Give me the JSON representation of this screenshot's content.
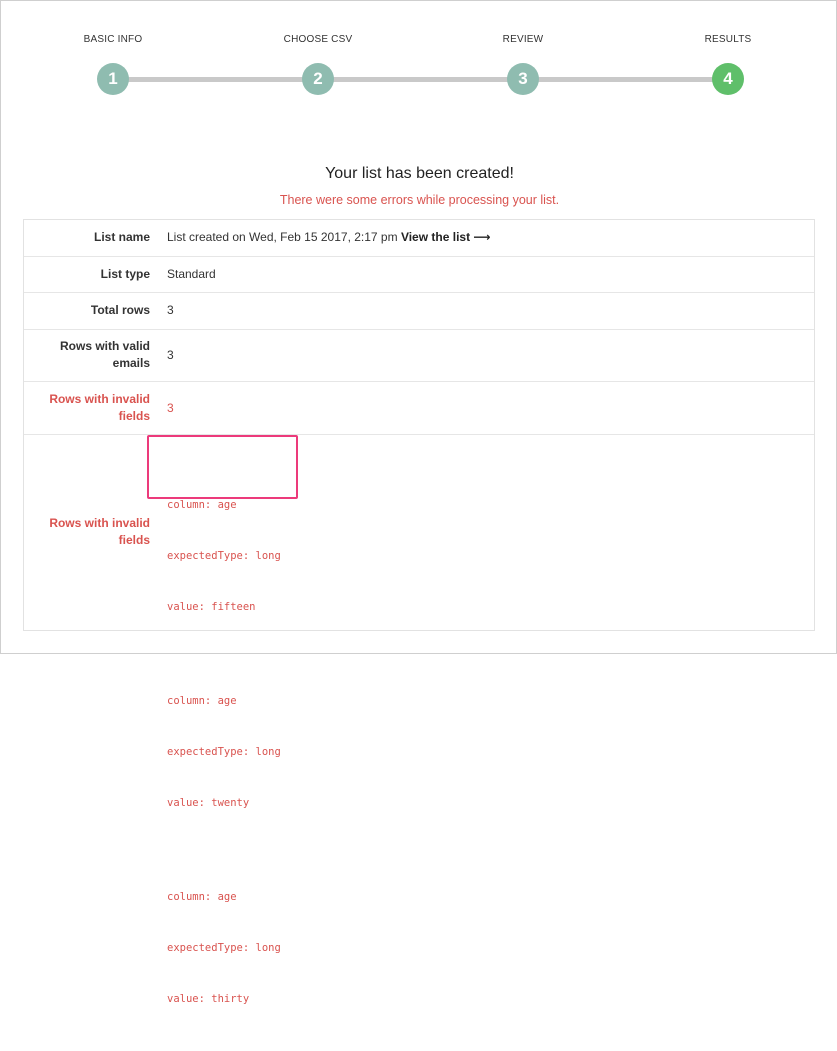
{
  "colors": {
    "step_done": "#8fbcb0",
    "step_active": "#5fbf6a",
    "error_red": "#d9534f",
    "highlight": "#ec3a7b"
  },
  "steps": [
    {
      "label": "BASIC INFO",
      "number": "1",
      "state": "done"
    },
    {
      "label": "CHOOSE CSV",
      "number": "2",
      "state": "done"
    },
    {
      "label": "REVIEW",
      "number": "3",
      "state": "done"
    },
    {
      "label": "RESULTS",
      "number": "4",
      "state": "active"
    }
  ],
  "result": {
    "title": "Your list has been created!",
    "error_message": "There were some errors while processing your list."
  },
  "summary": {
    "list_name_label": "List name",
    "list_name_value": "List created on Wed, Feb 15 2017, 2:17 pm",
    "view_link": "View the list",
    "view_link_icon": "⟶",
    "list_type_label": "List type",
    "list_type_value": "Standard",
    "total_rows_label": "Total rows",
    "total_rows_value": "3",
    "valid_emails_label_1": "Rows with valid",
    "valid_emails_label_2": "emails",
    "valid_emails_value": "3",
    "invalid_fields_label_1": "Rows with invalid",
    "invalid_fields_label_2": "fields",
    "invalid_fields_value": "3"
  },
  "invalid_details": {
    "label_1": "Rows with invalid",
    "label_2": "fields",
    "errors": [
      {
        "column": "column: age",
        "expected": "expectedType: long",
        "value": "value: fifteen"
      },
      {
        "column": "column: age",
        "expected": "expectedType: long",
        "value": "value: twenty"
      },
      {
        "column": "column: age",
        "expected": "expectedType: long",
        "value": "value: thirty"
      }
    ]
  }
}
